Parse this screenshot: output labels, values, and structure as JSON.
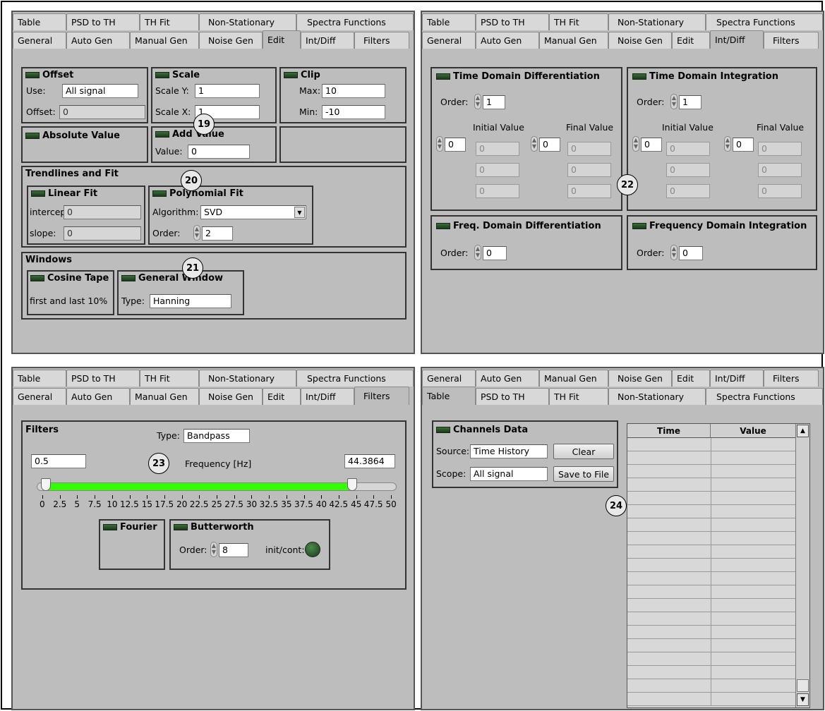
{
  "tabs_row_a": [
    "Table",
    "PSD to TH",
    "TH Fit",
    "Non-Stationary",
    "Spectra Functions"
  ],
  "tabs_row_b": [
    "General",
    "Auto Gen",
    "Manual Gen",
    "Noise Gen",
    "Edit",
    "Int/Diff",
    "Filters"
  ],
  "callouts": [
    "19",
    "20",
    "21",
    "22",
    "23",
    "24"
  ],
  "edit": {
    "offset": {
      "title": "Offset",
      "use_label": "Use:",
      "use_value": "All signal",
      "offset_label": "Offset:",
      "offset_value": "0"
    },
    "scale": {
      "title": "Scale",
      "y_label": "Scale Y:",
      "y_value": "1",
      "x_label": "Scale X:",
      "x_value": "1"
    },
    "clip": {
      "title": "Clip",
      "max_label": "Max:",
      "max_value": "10",
      "min_label": "Min:",
      "min_value": "-10"
    },
    "absolute": {
      "title": "Absolute Value"
    },
    "add": {
      "title": "Add Value",
      "value_label": "Value:",
      "value": "0"
    },
    "trend": {
      "title": "Trendlines and Fit",
      "linear": {
        "title": "Linear Fit",
        "intercept_label": "intercept:",
        "intercept_value": "0",
        "slope_label": "slope:",
        "slope_value": "0"
      },
      "poly": {
        "title": "Polynomial Fit",
        "algorithm_label": "Algorithm:",
        "algorithm_value": "SVD",
        "order_label": "Order:",
        "order_value": "2"
      }
    },
    "windows": {
      "title": "Windows",
      "cosine_title": "Cosine Tape",
      "cosine_text": "first and last 10%",
      "general_title": "General Window",
      "type_label": "Type:",
      "type_value": "Hanning"
    }
  },
  "intdiff": {
    "tdd": {
      "title": "Time Domain Differentiation",
      "order_label": "Order:",
      "order_value": "1",
      "initial_label": "Initial Value",
      "final_label": "Final Value",
      "initial_index": "0",
      "final_index": "0",
      "initial_values": [
        "0",
        "0",
        "0"
      ],
      "final_values": [
        "0",
        "0",
        "0"
      ]
    },
    "tdi": {
      "title": "Time Domain Integration",
      "order_label": "Order:",
      "order_value": "1",
      "initial_label": "Initial Value",
      "final_label": "Final Value",
      "initial_index": "0",
      "final_index": "0",
      "initial_values": [
        "0",
        "0",
        "0"
      ],
      "final_values": [
        "0",
        "0",
        "0"
      ]
    },
    "fdd": {
      "title": "Freq. Domain Differentiation",
      "order_label": "Order:",
      "order_value": "0"
    },
    "fdi": {
      "title": "Frequency Domain Integration",
      "order_label": "Order:",
      "order_value": "0"
    }
  },
  "filters": {
    "title": "Filters",
    "type_label": "Type:",
    "type_value": "Bandpass",
    "low_value": "0.5",
    "high_value": "44.3864",
    "freq_label": "Frequency [Hz]",
    "slider": {
      "min": 0,
      "max": 50,
      "low": 0.5,
      "high": 44.3864,
      "ticks": [
        "0",
        "2.5",
        "5",
        "7.5",
        "10",
        "12.5",
        "15",
        "17.5",
        "20",
        "22.5",
        "25",
        "27.5",
        "30",
        "32.5",
        "35",
        "37.5",
        "40",
        "42.5",
        "45",
        "47.5",
        "50"
      ],
      "fill_color": "#33ff00"
    },
    "fourier_title": "Fourier",
    "butter_title": "Butterworth",
    "order_label": "Order:",
    "order_value": "8",
    "initcont_label": "init/cont:"
  },
  "table": {
    "channels_title": "Channels Data",
    "source_label": "Source:",
    "source_value": "Time History",
    "scope_label": "Scope:",
    "scope_value": "All signal",
    "clear_label": "Clear",
    "save_label": "Save to File",
    "col_time": "Time",
    "col_value": "Value"
  }
}
